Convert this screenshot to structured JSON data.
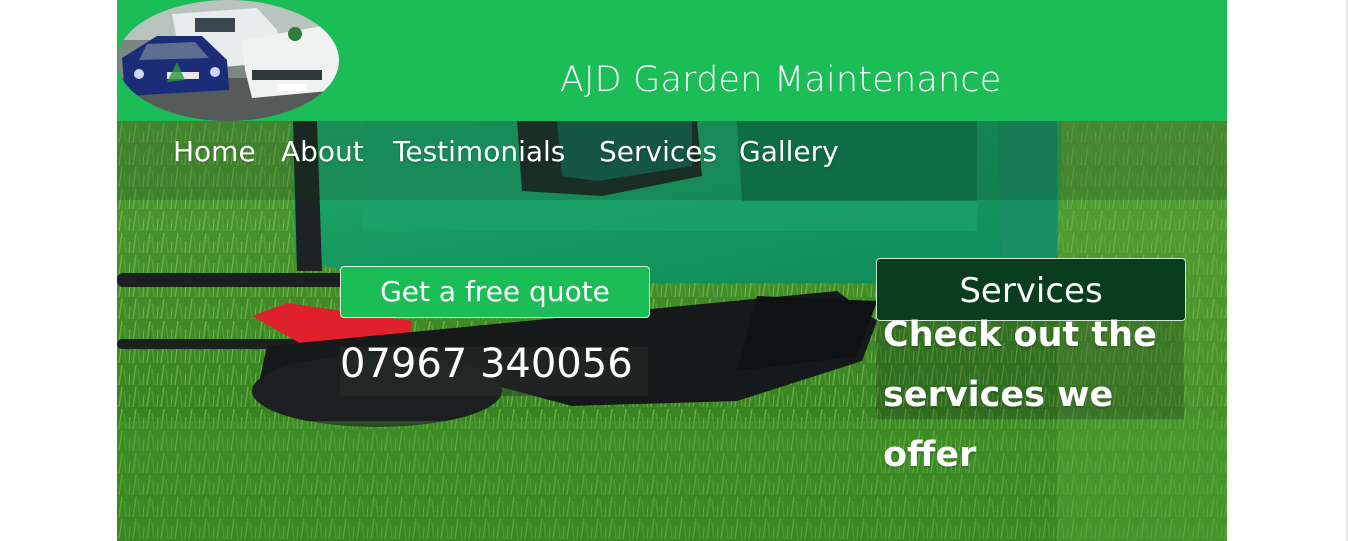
{
  "header": {
    "site_title": "AJD Garden Maintenance",
    "logo_icon": "van-fleet-photo",
    "background_color": "#1bbd57"
  },
  "nav": {
    "items": [
      {
        "label": "Home"
      },
      {
        "label": "About"
      },
      {
        "label": "Testimonials"
      },
      {
        "label": "Services"
      },
      {
        "label": "Gallery"
      }
    ]
  },
  "hero": {
    "background_image": "green-lawn-mower-on-grass",
    "quote_button_label": "Get a free quote",
    "phone_number": "07967 340056",
    "services_button_label": "Services",
    "services_text": "Check out the services we offer"
  },
  "colors": {
    "accent": "#1bbd57",
    "dark_button": "#0a3d1e"
  }
}
